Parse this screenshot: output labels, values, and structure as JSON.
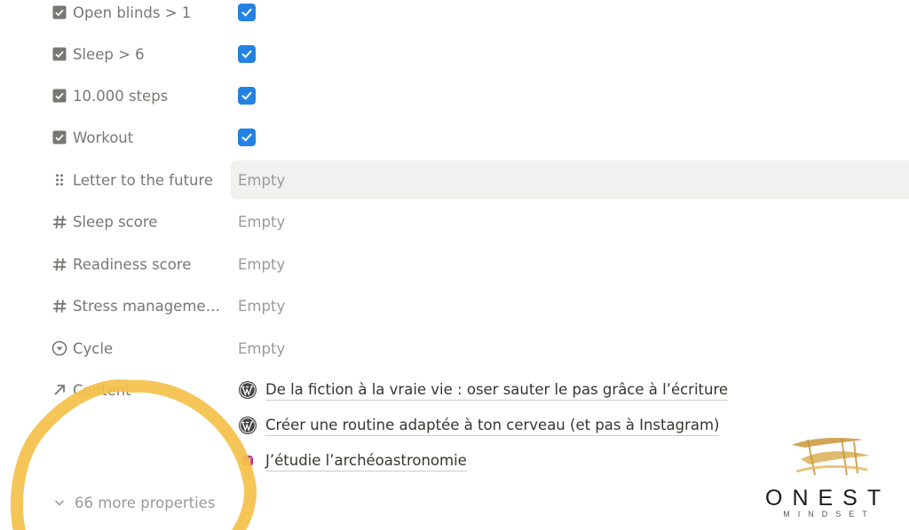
{
  "properties": [
    {
      "label": "Open blinds > 1",
      "icon": "checkbox-icon",
      "type": "checkbox",
      "checked": true
    },
    {
      "label": "Sleep > 6",
      "icon": "checkbox-icon",
      "type": "checkbox",
      "checked": true
    },
    {
      "label": "10.000 steps",
      "icon": "checkbox-icon",
      "type": "checkbox",
      "checked": true
    },
    {
      "label": "Workout",
      "icon": "checkbox-icon",
      "type": "checkbox",
      "checked": true
    },
    {
      "label": "Letter to the future",
      "icon": "drag-handle-icon",
      "type": "text",
      "value": "Empty"
    },
    {
      "label": "Sleep score",
      "icon": "hash-icon",
      "type": "number",
      "value": "Empty"
    },
    {
      "label": "Readiness score",
      "icon": "hash-icon",
      "type": "number",
      "value": "Empty"
    },
    {
      "label": "Stress managemen...",
      "icon": "hash-icon",
      "type": "number",
      "value": "Empty"
    },
    {
      "label": "Cycle",
      "icon": "status-icon",
      "type": "status",
      "value": "Empty"
    }
  ],
  "content_property": {
    "label": "Content",
    "icon": "relation-arrow-icon",
    "items": [
      {
        "title": "De la fiction à la vraie vie : oser sauter le pas grâce à l’écriture",
        "icon": "wordpress-icon"
      },
      {
        "title": "Créer une routine adaptée à ton cerveau (et pas à Instagram)",
        "icon": "wordpress-icon"
      },
      {
        "title": "J’étudie l’archéoastronomie",
        "icon": "instagram-icon"
      }
    ]
  },
  "more_properties": {
    "label": "66 more properties"
  },
  "logo": {
    "word": "ONEST",
    "sub": "MINDSET"
  },
  "colors": {
    "accent": "#2383e2",
    "label": "#787774",
    "placeholder": "#9b9a97",
    "hover": "#f1f1ef",
    "annotation": "#f5c04a",
    "logo_gold": "#c9973a"
  }
}
